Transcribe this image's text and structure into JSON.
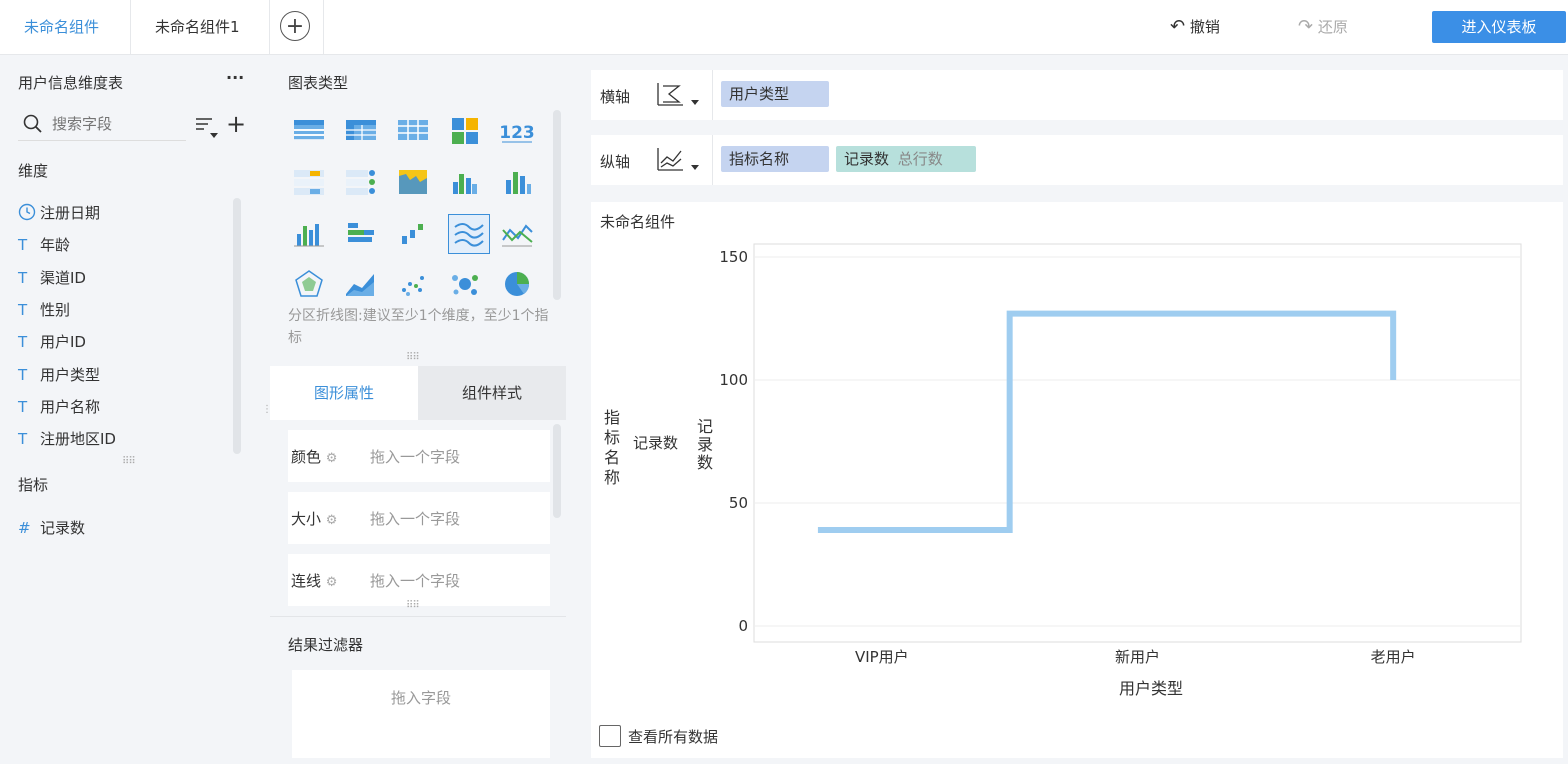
{
  "tabs": [
    {
      "label": "未命名组件",
      "active": true
    },
    {
      "label": "未命名组件1",
      "active": false
    }
  ],
  "toolbar": {
    "undo": "撤销",
    "redo": "还原",
    "enter_dashboard": "进入仪表板"
  },
  "left": {
    "table_name": "用户信息维度表",
    "more": "···",
    "search_placeholder": "搜索字段",
    "dimension_title": "维度",
    "dimensions": [
      {
        "label": "注册日期",
        "icon": "clock-icon"
      },
      {
        "label": "年龄",
        "icon": "text-T-icon"
      },
      {
        "label": "渠道ID",
        "icon": "text-T-icon"
      },
      {
        "label": "性别",
        "icon": "text-T-icon"
      },
      {
        "label": "用户ID",
        "icon": "text-T-icon"
      },
      {
        "label": "用户类型",
        "icon": "text-T-icon"
      },
      {
        "label": "用户名称",
        "icon": "text-T-icon"
      },
      {
        "label": "注册地区ID",
        "icon": "text-T-icon"
      }
    ],
    "metric_title": "指标",
    "metrics": [
      {
        "label": "记录数",
        "icon": "hash-icon"
      }
    ]
  },
  "middle": {
    "chart_type_title": "图表类型",
    "chart_hint": "分区折线图:建议至少1个维度，至少1个指标",
    "tabs": [
      "图形属性",
      "组件样式"
    ],
    "props": [
      {
        "label": "颜色",
        "placeholder": "拖入一个字段"
      },
      {
        "label": "大小",
        "placeholder": "拖入一个字段"
      },
      {
        "label": "连线",
        "placeholder": "拖入一个字段"
      }
    ],
    "filter_title": "结果过滤器",
    "filter_placeholder": "拖入字段"
  },
  "axes": {
    "x_label": "横轴",
    "x_fields": [
      "用户类型"
    ],
    "y_label": "纵轴",
    "y_fields": [
      "指标名称"
    ],
    "y_metric": "记录数",
    "y_metric_sub": "总行数"
  },
  "chart": {
    "title": "未命名组件",
    "legend_group": "指标名称",
    "legend_item": "记录数",
    "y_axis_label": "记录数",
    "view_all": "查看所有数据"
  },
  "chart_data": {
    "type": "line",
    "step": true,
    "categories": [
      "VIP用户",
      "新用户",
      "老用户"
    ],
    "series": [
      {
        "values": [
          39,
          127,
          100
        ]
      }
    ],
    "xlabel": "用户类型",
    "ylabel": "记录数",
    "ylim": [
      0,
      150
    ],
    "yticks": [
      0,
      50,
      100,
      150
    ],
    "color": "#9fcdf0"
  }
}
